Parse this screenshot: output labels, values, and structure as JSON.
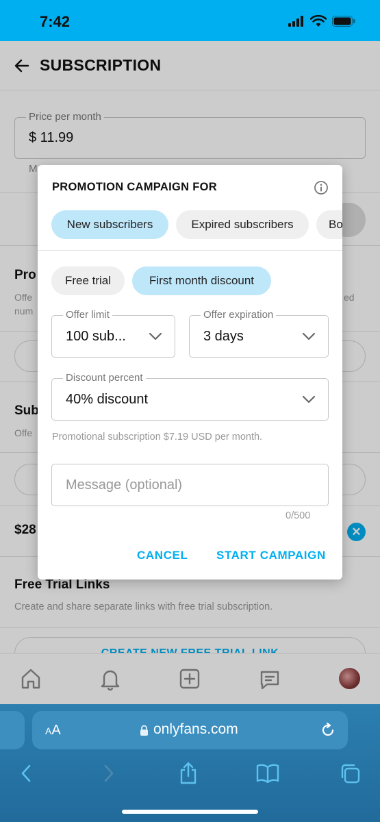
{
  "status_bar": {
    "time": "7:42"
  },
  "page": {
    "title": "SUBSCRIPTION",
    "price_field": {
      "label": "Price per month",
      "value": "$ 11.99"
    },
    "price_note": "M",
    "promo_section": {
      "title": "Pro",
      "subtitle_line1": "Offe",
      "subtitle_line2": "num",
      "subtitle_right": "ed"
    },
    "bundle_section": {
      "title": "Sub",
      "subtitle": "Offe"
    },
    "bundle_price": "$28",
    "free_trial": {
      "title": "Free Trial Links",
      "subtitle": "Create and share separate links with free trial subscription.",
      "button": "CREATE NEW FREE TRIAL LINK"
    }
  },
  "nav": {
    "items": [
      "home-icon",
      "bell-icon",
      "plus-square-icon",
      "chat-icon",
      "avatar"
    ]
  },
  "modal": {
    "title": "PROMOTION CAMPAIGN FOR",
    "audience_tabs": [
      {
        "label": "New subscribers",
        "active": true
      },
      {
        "label": "Expired subscribers",
        "active": false
      },
      {
        "label": "Bo",
        "active": false
      }
    ],
    "type_tabs": [
      {
        "label": "Free trial",
        "active": false
      },
      {
        "label": "First month discount",
        "active": true
      }
    ],
    "offer_limit": {
      "label": "Offer limit",
      "value": "100 sub..."
    },
    "offer_expiration": {
      "label": "Offer expiration",
      "value": "3 days"
    },
    "discount_percent": {
      "label": "Discount percent",
      "value": "40% discount"
    },
    "helper": "Promotional subscription $7.19 USD per month.",
    "message": {
      "placeholder": "Message (optional)",
      "counter": "0/500"
    },
    "cancel_label": "CANCEL",
    "start_label": "START CAMPAIGN"
  },
  "browser": {
    "aa_small": "A",
    "aa_large": "A",
    "url": "onlyfans.com"
  },
  "colors": {
    "accent": "#00aff0",
    "chip_active": "#bfe7fa",
    "chip_inactive": "#efefef",
    "safari_bar": "#2c7fb0"
  }
}
